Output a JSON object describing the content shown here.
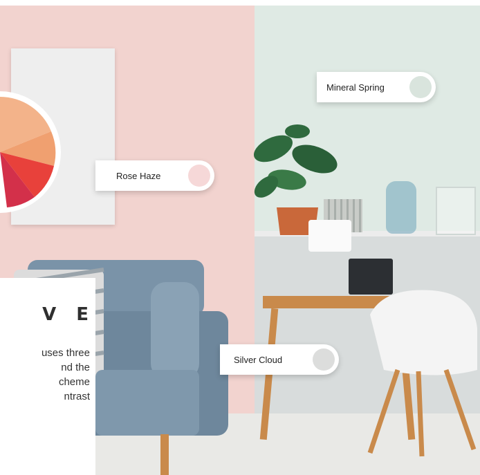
{
  "tags": {
    "mineral_spring": {
      "label": "Mineral Spring",
      "swatch_color": "#d9e4dd"
    },
    "rose_haze": {
      "label": "Rose Haze",
      "swatch_color": "#f6d8d8"
    },
    "silver_cloud": {
      "label": "Silver Cloud",
      "swatch_color": "#dcdddc"
    }
  },
  "info": {
    "heading": "V E",
    "lines": [
      "uses three",
      "nd the",
      "cheme",
      "ntrast"
    ]
  },
  "colors": {
    "wall_pink": "#f2d3cf",
    "wall_green": "#dfeae4",
    "sofa": "#7a93a8",
    "wood": "#c98a4b"
  },
  "icons": {
    "color_wheel": "color-wheel-icon"
  }
}
